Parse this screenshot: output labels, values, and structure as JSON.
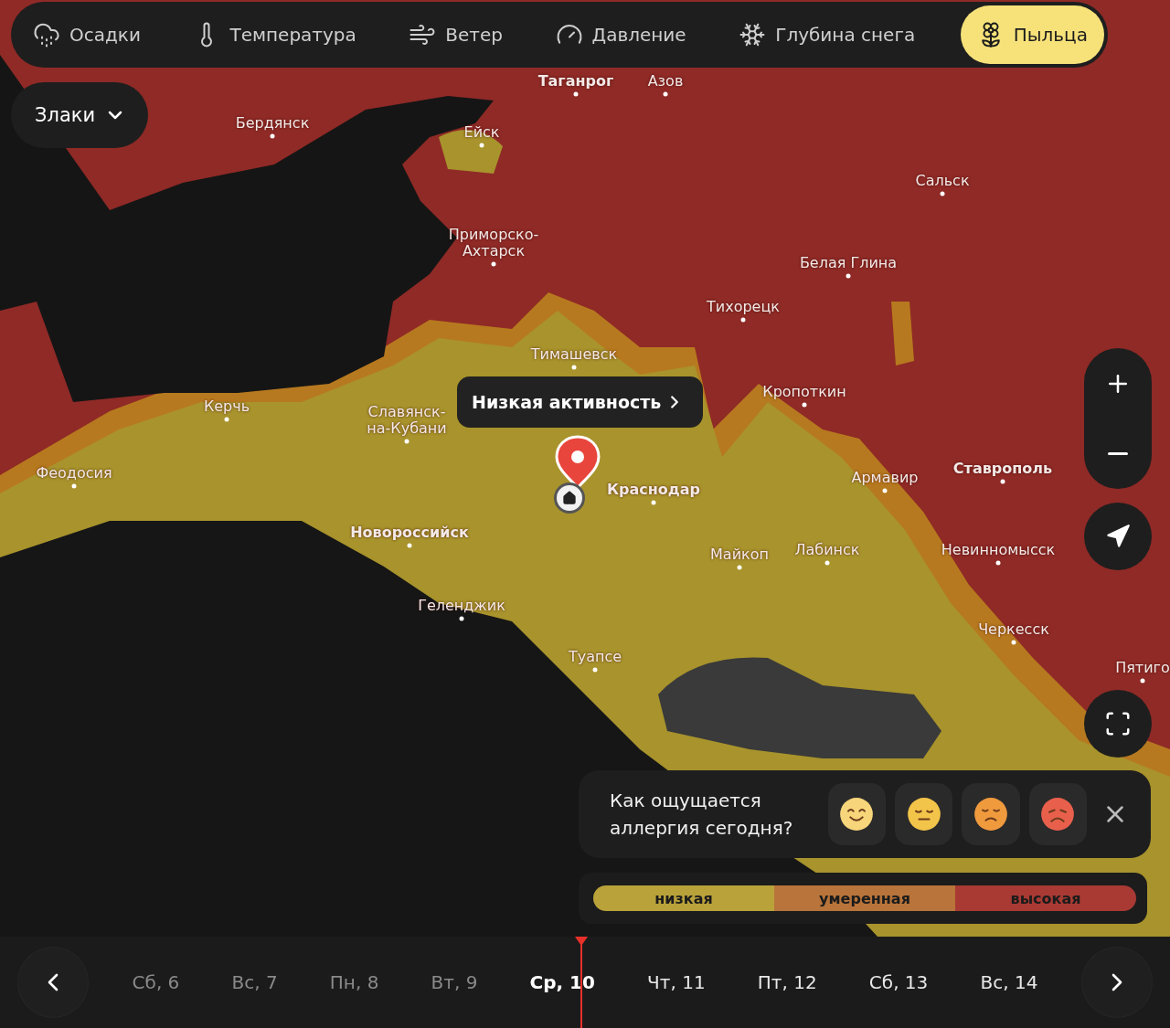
{
  "layers": [
    {
      "label": "Осадки",
      "selected": false
    },
    {
      "label": "Температура",
      "selected": false
    },
    {
      "label": "Ветер",
      "selected": false
    },
    {
      "label": "Давление",
      "selected": false
    },
    {
      "label": "Глубина снега",
      "selected": false
    },
    {
      "label": "Пыльца",
      "selected": true
    }
  ],
  "pollen_filter": {
    "value": "Злаки"
  },
  "cities": [
    {
      "name": "Таганрог",
      "bold": true
    },
    {
      "name": "Азов",
      "bold": false
    },
    {
      "name": "Бердянск",
      "bold": false
    },
    {
      "name": "Ейск",
      "bold": false
    },
    {
      "name": "Сальск",
      "bold": false
    },
    {
      "name": "Приморско-\nАхтарск",
      "bold": false
    },
    {
      "name": "Белая Глина",
      "bold": false
    },
    {
      "name": "Тихорецк",
      "bold": false
    },
    {
      "name": "Тимашевск",
      "bold": false
    },
    {
      "name": "Кропоткин",
      "bold": false
    },
    {
      "name": "Керчь",
      "bold": false
    },
    {
      "name": "Славянск-\nна-Кубани",
      "bold": false
    },
    {
      "name": "Феодосия",
      "bold": false
    },
    {
      "name": "Краснодар",
      "bold": true
    },
    {
      "name": "Армавир",
      "bold": false
    },
    {
      "name": "Ставрополь",
      "bold": true
    },
    {
      "name": "Новороссийск",
      "bold": true
    },
    {
      "name": "Майкоп",
      "bold": false
    },
    {
      "name": "Лабинск",
      "bold": false
    },
    {
      "name": "Невинномысск",
      "bold": false
    },
    {
      "name": "Геленджик",
      "bold": false
    },
    {
      "name": "Черкесск",
      "bold": false
    },
    {
      "name": "Туапсе",
      "bold": false
    },
    {
      "name": "Пятиго",
      "bold": false
    }
  ],
  "activity_popup": {
    "label": "Низкая активность"
  },
  "feedback": {
    "question": "Как ощущается аллергия сегодня?",
    "moods": [
      {
        "kind": "happy",
        "color": "#f7d57a"
      },
      {
        "kind": "neutral",
        "color": "#f3c44a"
      },
      {
        "kind": "sad",
        "color": "#f09a3e"
      },
      {
        "kind": "upset",
        "color": "#e8604c"
      }
    ]
  },
  "legend": [
    {
      "label": "низкая",
      "color": "#b9a23a"
    },
    {
      "label": "умеренная",
      "color": "#b8743a"
    },
    {
      "label": "высокая",
      "color": "#a83a33"
    }
  ],
  "days": [
    {
      "label": "Сб, 6",
      "selected": false,
      "past": true
    },
    {
      "label": "Вс, 7",
      "selected": false,
      "past": true
    },
    {
      "label": "Пн, 8",
      "selected": false,
      "past": true
    },
    {
      "label": "Вт, 9",
      "selected": false,
      "past": true
    },
    {
      "label": "Ср, 10",
      "selected": true,
      "past": false
    },
    {
      "label": "Чт, 11",
      "selected": false,
      "past": false
    },
    {
      "label": "Пт, 12",
      "selected": false,
      "past": false
    },
    {
      "label": "Сб, 13",
      "selected": false,
      "past": false
    },
    {
      "label": "Вс, 14",
      "selected": false,
      "past": false
    }
  ]
}
